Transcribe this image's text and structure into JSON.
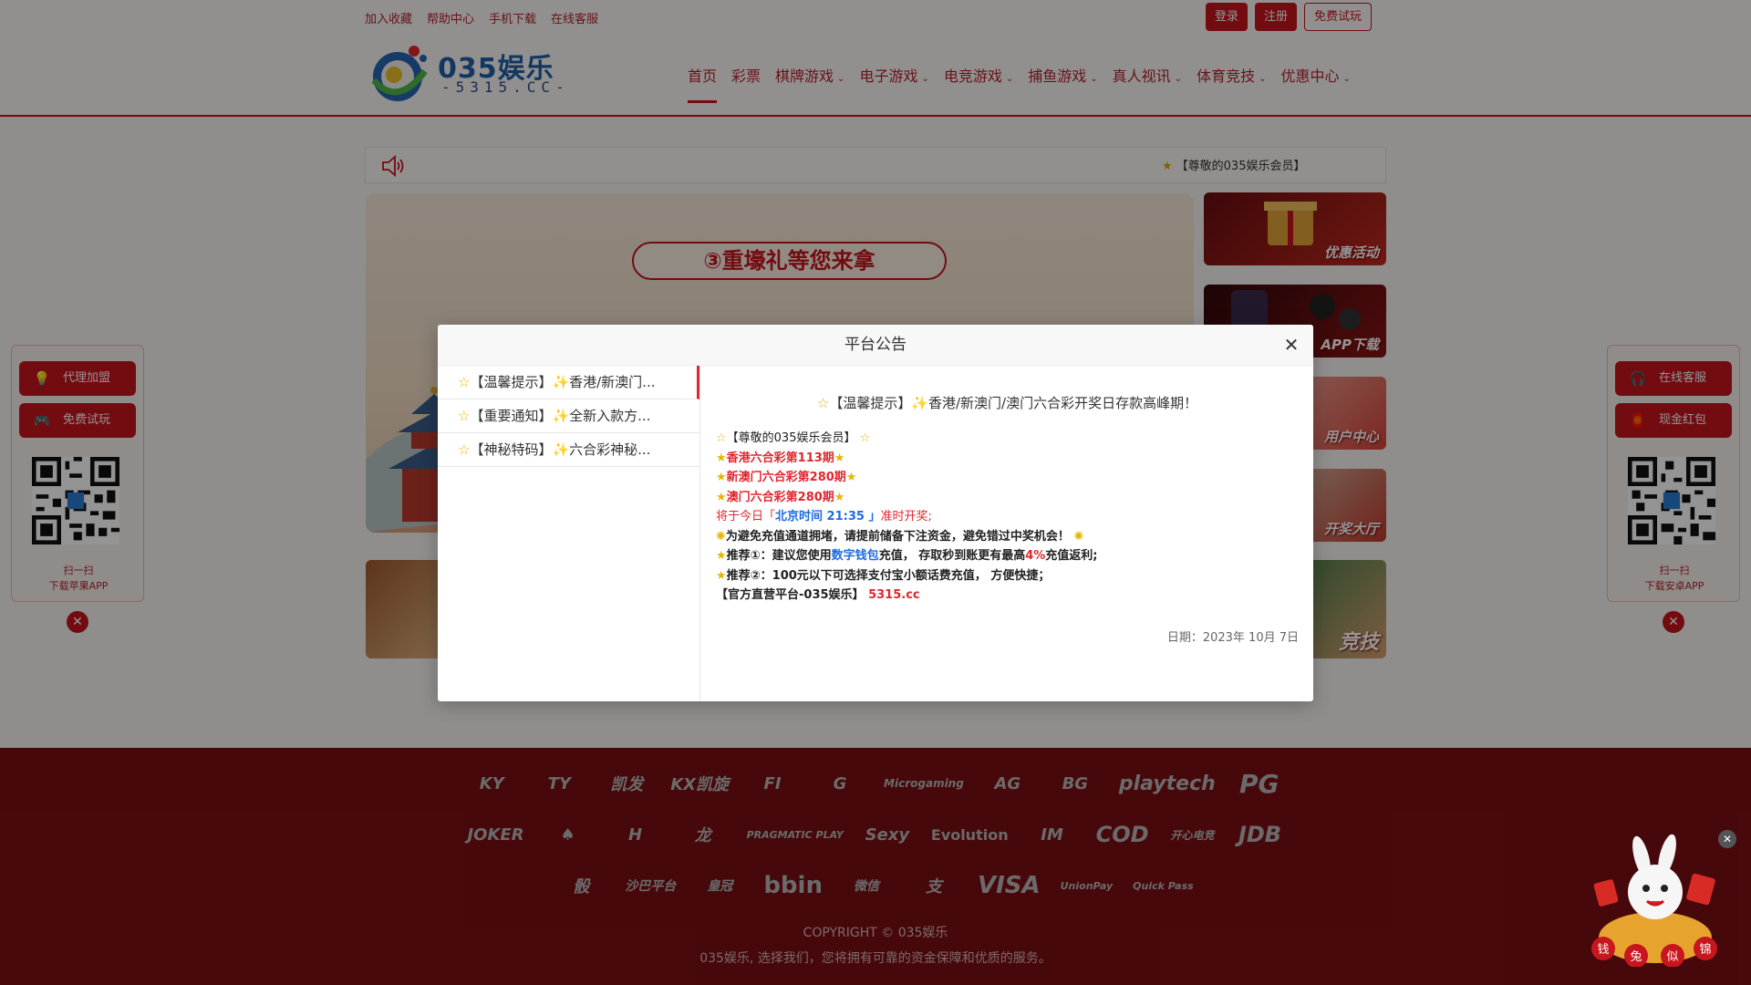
{
  "header": {
    "toplinks": [
      "加入收藏",
      "帮助中心",
      "手机下载",
      "在线客服"
    ],
    "buttons": {
      "login": "登录",
      "register": "注册",
      "trial": "免费试玩"
    },
    "logo": {
      "main": "035娱乐",
      "sub": "-5315.CC-"
    },
    "nav": [
      {
        "label": "首页",
        "dropdown": false
      },
      {
        "label": "彩票",
        "dropdown": false
      },
      {
        "label": "棋牌游戏",
        "dropdown": true
      },
      {
        "label": "电子游戏",
        "dropdown": true
      },
      {
        "label": "电竞游戏",
        "dropdown": true
      },
      {
        "label": "捕鱼游戏",
        "dropdown": true
      },
      {
        "label": "真人视讯",
        "dropdown": true
      },
      {
        "label": "体育竞技",
        "dropdown": true
      },
      {
        "label": "优惠中心",
        "dropdown": true
      }
    ]
  },
  "noticebar": {
    "marquee": "【尊敬的035娱乐会员】"
  },
  "banner": {
    "pill": "③重壕礼等您来拿"
  },
  "promos": [
    "优惠活动",
    "APP下载",
    "用户中心",
    "开奖大厅"
  ],
  "bottom_cards": {
    "right_label": "竞技"
  },
  "left_panel": {
    "btn1": "代理加盟",
    "btn2": "免费试玩",
    "qr_line1": "扫一扫",
    "qr_line2": "下载苹果APP"
  },
  "right_panel": {
    "btn1": "在线客服",
    "btn2": "现金红包",
    "qr_line1": "扫一扫",
    "qr_line2": "下载安卓APP"
  },
  "footer": {
    "providers_row1": [
      "KY",
      "TY",
      "凯发",
      "KX凯旋",
      "FI",
      "G",
      "Microgaming",
      "AG",
      "BG",
      "playtech",
      "PG"
    ],
    "providers_row2": [
      "JOKER",
      "♠",
      "H",
      "龙",
      "PRAGMATIC PLAY",
      "Sexy",
      "Evolution",
      "IM",
      "COD",
      "开心电竞",
      "JDB"
    ],
    "providers_row3": [
      "骰",
      "沙巴平台",
      "皇冠",
      "bbin",
      "微信",
      "支",
      "VISA",
      "UnionPay",
      "Quick Pass"
    ],
    "copyright": "COPYRIGHT © 035娱乐",
    "slogan": "035娱乐, 选择我们，您将拥有可靠的资金保障和优质的服务。"
  },
  "mascot": {
    "text": "钱兔似锦"
  },
  "modal": {
    "title": "平台公告",
    "tabs": [
      "【温馨提示】✨香港/新澳门...",
      "【重要通知】✨全新入款方...",
      "【神秘特码】✨六合彩神秘..."
    ],
    "heading": "【温馨提示】✨香港/新澳门/澳门六合彩开奖日存款高峰期！",
    "greet": "【尊敬的035娱乐会员】",
    "lines": {
      "hk": "香港六合彩第113期",
      "newmacau": "新澳门六合彩第280期",
      "macau": "澳门六合彩第280期",
      "draw_pre": "将于今日「",
      "draw_time": "北京时间 21:35 」",
      "draw_post": "准时开奖;",
      "warn": "为避免充值通道拥堵，请提前储备下注资金，避免错过中奖机会！",
      "rec1_pre": "推荐①：建议您使用",
      "rec1_link": "数字钱包",
      "rec1_mid": "充值， 存取秒到账更有最高",
      "rec1_pct": "4%",
      "rec1_post": "充值返利;",
      "rec2": "推荐②：100元以下可选择支付宝小额话费充值， 方便快捷；",
      "official_pre": "【官方直营平台-035娱乐】",
      "official_url": "5315.cc"
    },
    "date": "日期：2023年 10月 7日"
  }
}
